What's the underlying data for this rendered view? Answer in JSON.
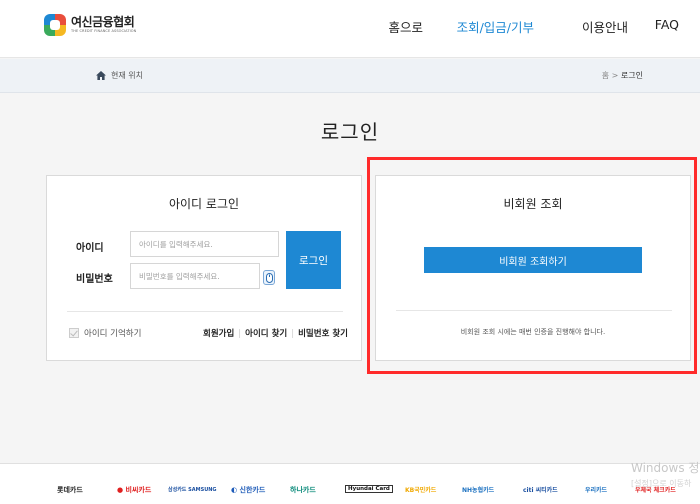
{
  "header": {
    "logo_main": "여신금융협회",
    "logo_sub": "THE CREDIT FINANCE ASSOCIATION",
    "nav": [
      {
        "label": "홈으로"
      },
      {
        "label": "조회/입금/기부"
      },
      {
        "label": "이용안내"
      },
      {
        "label": "FAQ"
      }
    ]
  },
  "breadcrumb": {
    "label": "현재 위치",
    "home": "홈",
    "separator": ">",
    "current": "로그인"
  },
  "page_title": "로그인",
  "id_login": {
    "title": "아이디 로그인",
    "id_label": "아이디",
    "id_placeholder": "아이디를 입력해주세요.",
    "pw_label": "비밀번호",
    "pw_placeholder": "비밀번호를 입력해주세요.",
    "login_button": "로그인",
    "remember_label": "아이디 기억하기",
    "links": {
      "signup": "회원가입",
      "find_id": "아이디 찾기",
      "find_pw": "비밀번호 찾기"
    }
  },
  "nonmember": {
    "title": "비회원 조회",
    "button": "비회원 조회하기",
    "notice": "비회원 조회 시에는 매번 인증을 진행해야 합니다."
  },
  "footer_brands": [
    {
      "label": "롯데카드",
      "color": "#222222"
    },
    {
      "label": "● 비씨카드",
      "color": "#e02020"
    },
    {
      "label": "삼성카드 SAMSUNG",
      "color": "#1a4fa0"
    },
    {
      "label": "◐ 신한카드",
      "color": "#1e5bb8"
    },
    {
      "label": "하나카드",
      "color": "#0a8a7a"
    },
    {
      "label": "Hyundai Card",
      "color": "#111111"
    },
    {
      "label": "KB국민카드",
      "color": "#f0a800"
    },
    {
      "label": "NH농협카드",
      "color": "#1a70c0"
    },
    {
      "label": "citi 씨티카드",
      "color": "#1a4fa0"
    },
    {
      "label": "우리카드",
      "color": "#1a70c0"
    },
    {
      "label": "우체국 체크카드",
      "color": "#e02020"
    }
  ],
  "watermark": {
    "title": "Windows 정",
    "sub": "[설정]으로 이동하"
  },
  "colors": {
    "accent": "#1e88d3",
    "highlight": "#ff2a2a"
  }
}
